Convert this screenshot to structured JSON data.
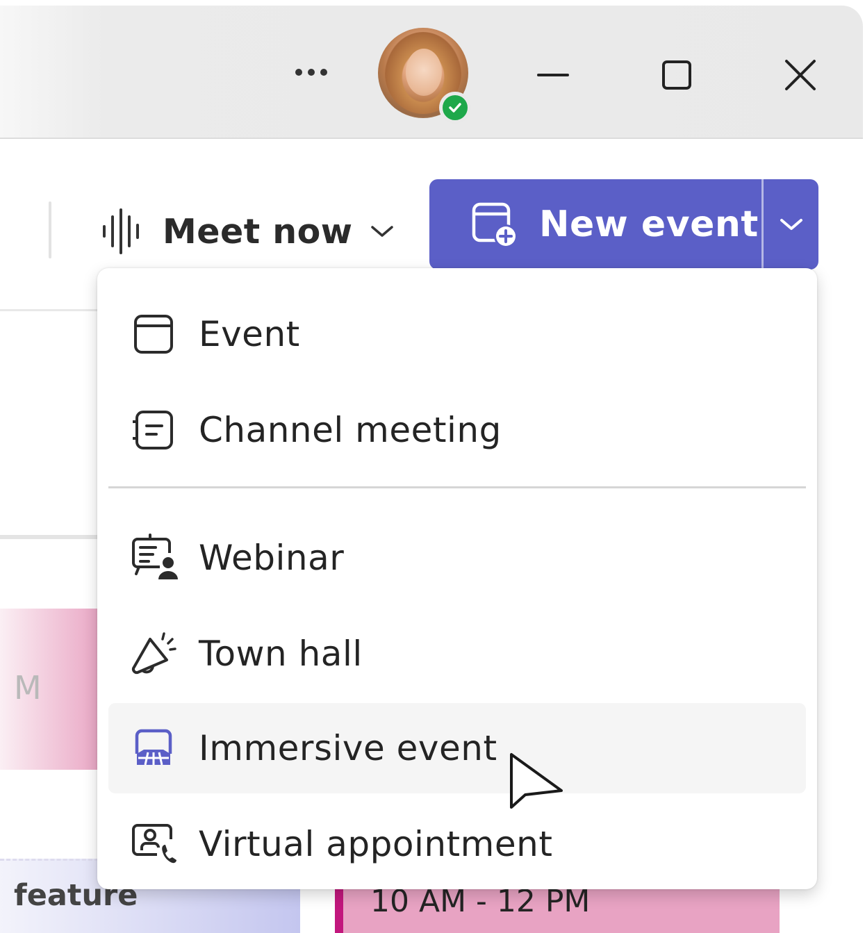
{
  "titlebar": {
    "more_icon": "more-horizontal-icon",
    "presence_status": "available",
    "minimize_icon": "minimize-icon",
    "maximize_icon": "maximize-icon",
    "close_icon": "close-icon"
  },
  "toolbar": {
    "meet_now_label": "Meet now",
    "new_event_label": "New event"
  },
  "menu": {
    "items": [
      {
        "label": "Event",
        "icon": "calendar-icon"
      },
      {
        "label": "Channel meeting",
        "icon": "channel-meeting-icon"
      },
      {
        "label": "Webinar",
        "icon": "webinar-icon"
      },
      {
        "label": "Town hall",
        "icon": "megaphone-icon"
      },
      {
        "label": "Immersive event",
        "icon": "immersive-event-icon",
        "hovered": true
      },
      {
        "label": "Virtual appointment",
        "icon": "virtual-appointment-icon"
      }
    ]
  },
  "background": {
    "pink_event_text": "M",
    "purple_event_text": "feature",
    "magenta_event_time": "10 AM - 12 PM"
  },
  "colors": {
    "brand": "#5b5fc7",
    "presence_green": "#1ea84a",
    "event_pink": "#e8a3c3",
    "event_magenta": "#c2177d",
    "event_purple": "#c4c6ef"
  }
}
